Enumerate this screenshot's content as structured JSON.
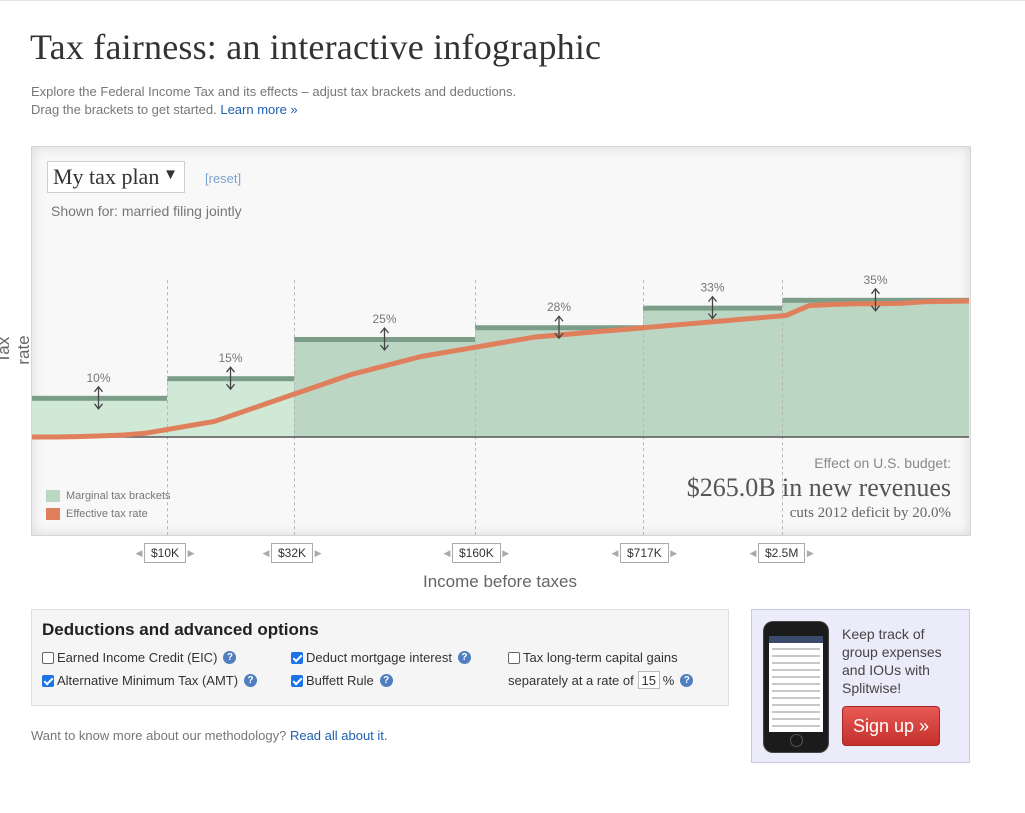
{
  "page": {
    "title": "Tax fairness: an interactive infographic",
    "intro_line1": "Explore the Federal Income Tax and its effects – adjust tax brackets and deductions.",
    "intro_line2": "Drag the brackets to get started.",
    "learn_more": "Learn more »"
  },
  "plan": {
    "selected": "My tax plan",
    "reset": "[reset]",
    "shown_for": "Shown for: married filing jointly"
  },
  "chart_data": {
    "type": "area",
    "ylabel": "Tax rate",
    "xlabel": "Income before taxes",
    "brackets": [
      {
        "rate": 10,
        "label": "10%"
      },
      {
        "rate": 15,
        "label": "15%"
      },
      {
        "rate": 25,
        "label": "25%"
      },
      {
        "rate": 28,
        "label": "28%"
      },
      {
        "rate": 33,
        "label": "33%"
      },
      {
        "rate": 35,
        "label": "35%"
      }
    ],
    "thresholds": [
      "$10K",
      "$32K",
      "$160K",
      "$717K",
      "$2.5M"
    ],
    "effective_rate": [
      0,
      0,
      0.1,
      0.3,
      0.5,
      1,
      2,
      3,
      4,
      6,
      8,
      10,
      12,
      14,
      16,
      17.5,
      19,
      20.5,
      21.5,
      22.5,
      23.5,
      24.5,
      25.5,
      26,
      26.5,
      27,
      27.5,
      28,
      28.5,
      29,
      29.5,
      30,
      30.5,
      31,
      33.5,
      33.8,
      34,
      34,
      34.1,
      34.5,
      34.6,
      34.7
    ],
    "legend": [
      "Marginal tax brackets",
      "Effective tax rate"
    ],
    "colors": {
      "bracket_fill": "#bcd6c4",
      "bracket_fill_low": "#cfe9d6",
      "bracket_top": "#7c9e89",
      "effective": "#e07f5c"
    }
  },
  "budget": {
    "label": "Effect on U.S. budget:",
    "value": "$265.0B in new revenues",
    "sub": "cuts 2012 deficit by 20.0%"
  },
  "deductions": {
    "title": "Deductions and advanced options",
    "eic": {
      "label": "Earned Income Credit (EIC)",
      "checked": false
    },
    "amt": {
      "label": "Alternative Minimum Tax (AMT)",
      "checked": true
    },
    "mortgage": {
      "label": "Deduct mortgage interest",
      "checked": true
    },
    "buffett": {
      "label": "Buffett Rule",
      "checked": true
    },
    "capgains": {
      "label": "Tax long-term capital gains",
      "checked": false
    },
    "capgains_rate_prefix": "separately at a rate of",
    "capgains_rate": "15",
    "capgains_rate_suffix": "%",
    "help_glyph": "?"
  },
  "methodology": {
    "text": "Want to know more about our methodology?",
    "link": "Read all about it."
  },
  "promo": {
    "text": "Keep track of group expenses and IOUs with Splitwise!",
    "button": "Sign up »"
  }
}
